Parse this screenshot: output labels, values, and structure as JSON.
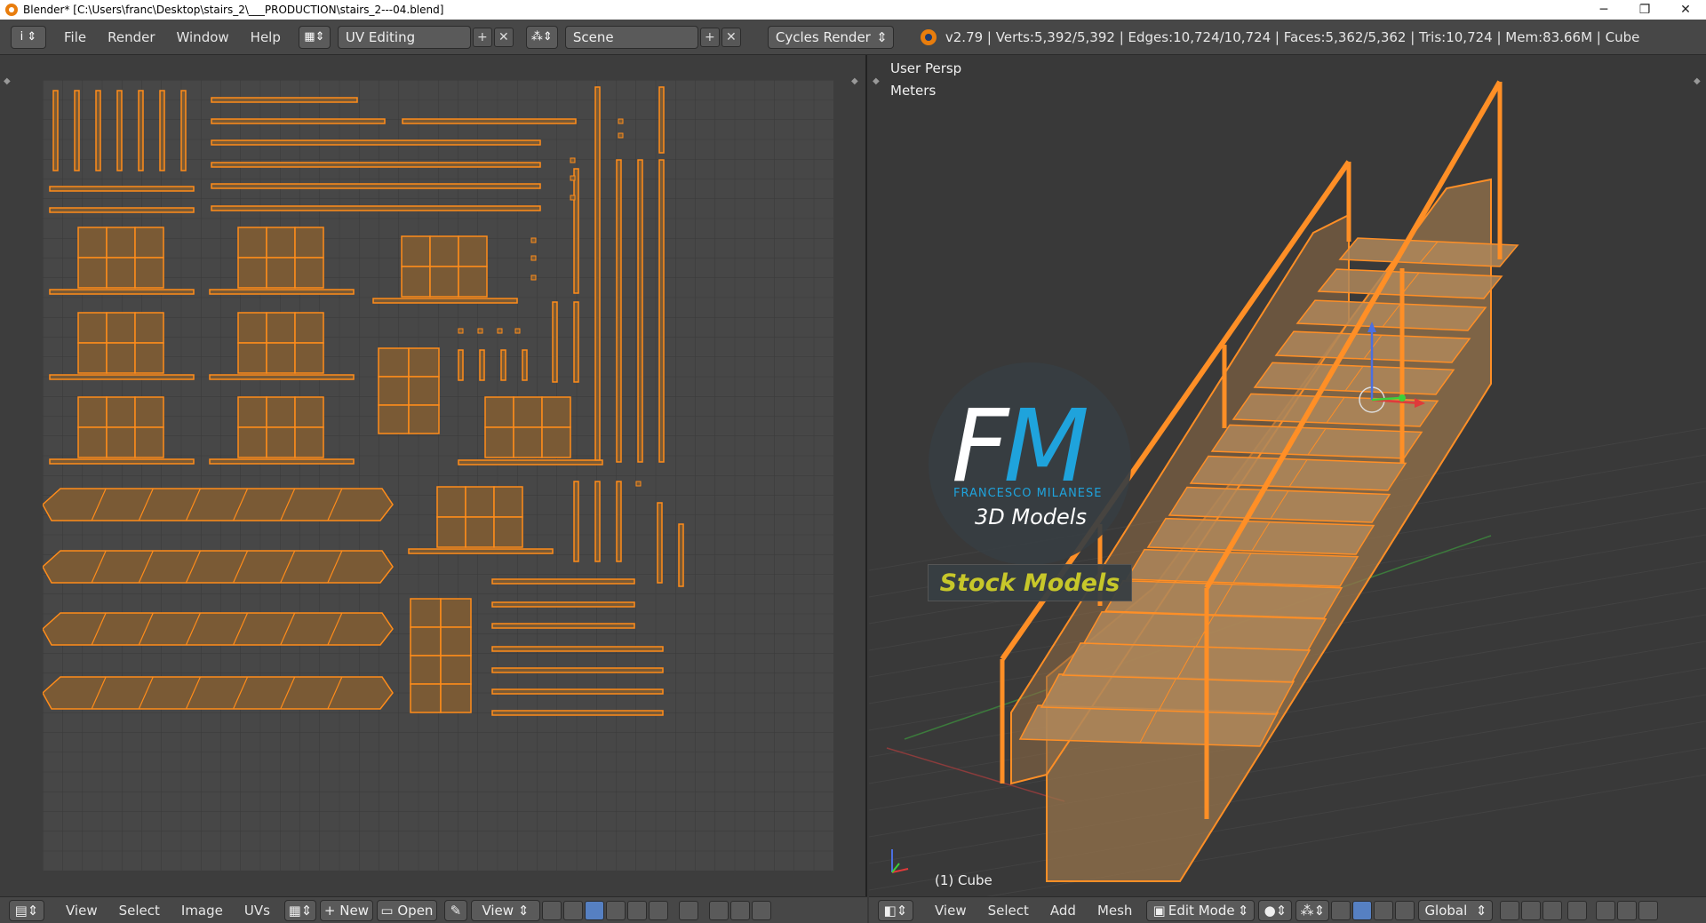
{
  "window": {
    "title": "Blender* [C:\\Users\\franc\\Desktop\\stairs_2\\___PRODUCTION\\stairs_2---04.blend]",
    "minimize": "─",
    "maximize": "❐",
    "close": "✕"
  },
  "topbar": {
    "editor_icon": "i",
    "menus": [
      "File",
      "Render",
      "Window",
      "Help"
    ],
    "screen_layout": "UV Editing",
    "scene": "Scene",
    "render_engine": "Cycles Render",
    "stats": "v2.79 | Verts:5,392/5,392 | Edges:10,724/10,724 | Faces:5,362/5,362 | Tris:10,724 | Mem:83.66M | Cube"
  },
  "viewport": {
    "view_name": "User Persp",
    "units": "Meters",
    "object_label": "(1) Cube"
  },
  "watermark": {
    "letter_f": "F",
    "letter_m": "M",
    "name": "FRANCESCO MILANESE",
    "subtitle": "3D Models",
    "badge": "Stock Models"
  },
  "uv_footer": {
    "menus": [
      "View",
      "Select",
      "Image",
      "UVs"
    ],
    "new_label": "New",
    "open_label": "Open",
    "view_label": "View"
  },
  "vp_footer": {
    "menus": [
      "View",
      "Select",
      "Add",
      "Mesh"
    ],
    "mode": "Edit Mode",
    "orientation": "Global"
  },
  "colors": {
    "uv_fill": "#7a5a35",
    "uv_edge": "#ff8c1a",
    "grid_bg": "#444444",
    "wire": "#ff8f26"
  }
}
